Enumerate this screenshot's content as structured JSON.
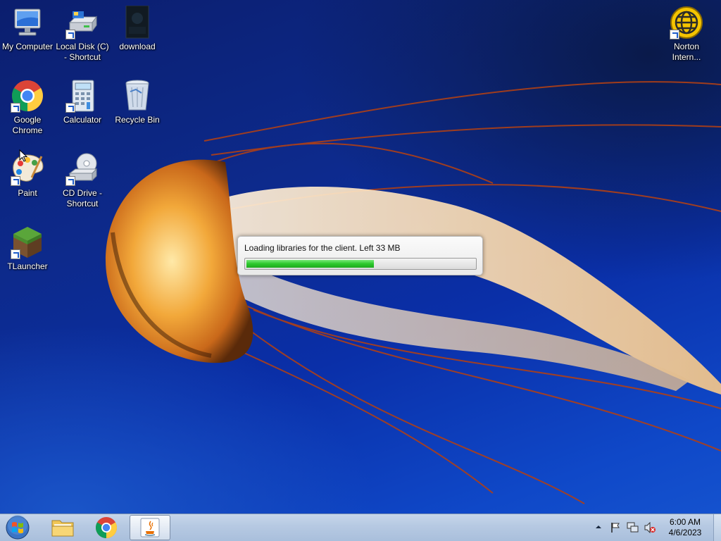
{
  "desktop": {
    "icons": [
      {
        "id": "my-computer",
        "label": "My Computer"
      },
      {
        "id": "local-disk-c",
        "label": "Local Disk (C)\n- Shortcut"
      },
      {
        "id": "download",
        "label": "download"
      },
      {
        "id": "google-chrome",
        "label": "Google\nChrome"
      },
      {
        "id": "calculator",
        "label": "Calculator"
      },
      {
        "id": "recycle-bin",
        "label": "Recycle Bin"
      },
      {
        "id": "paint",
        "label": "Paint"
      },
      {
        "id": "cd-drive",
        "label": "CD Drive -\nShortcut"
      },
      {
        "id": "tlauncher",
        "label": "TLauncher"
      },
      {
        "id": "norton",
        "label": "Norton\nIntern..."
      }
    ]
  },
  "loader": {
    "message": "Loading libraries for the client. Left 33 MB",
    "progress_fraction": 0.56,
    "fill_color": "#2cc92c"
  },
  "taskbar": {
    "buttons": [
      {
        "id": "start",
        "icon": "windows-logo-icon"
      },
      {
        "id": "explorer",
        "icon": "folder-icon"
      },
      {
        "id": "chrome",
        "icon": "chrome-icon"
      },
      {
        "id": "java",
        "icon": "java-icon",
        "active": true
      }
    ],
    "tray": {
      "icons": [
        "show-hidden-icons-chevron",
        "action-center-flag-icon",
        "network-icon",
        "volume-muted-icon"
      ],
      "time": "6:00 AM",
      "date": "4/6/2023"
    }
  }
}
